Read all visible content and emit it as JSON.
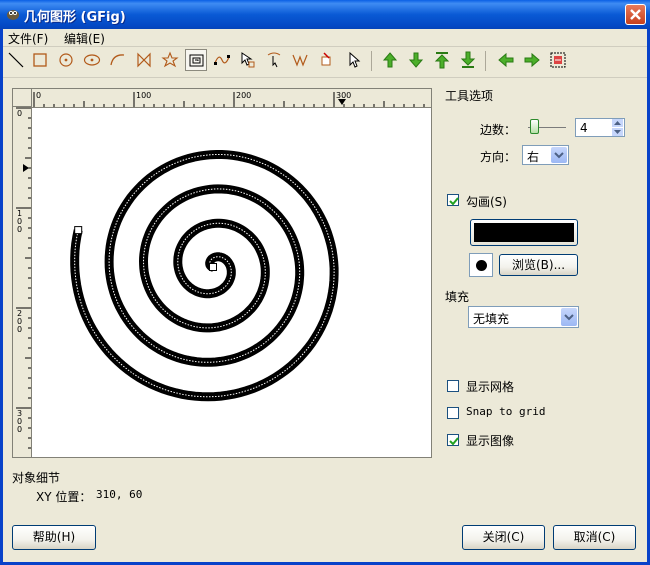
{
  "window": {
    "title": "几何图形 (GFig)"
  },
  "menu": {
    "file": "文件(F)",
    "edit": "编辑(E)"
  },
  "toolbar": {
    "tools": [
      "line-tool",
      "rectangle-tool",
      "circle-tool",
      "ellipse-tool",
      "arc-tool",
      "polygon-tool",
      "star-tool",
      "spiral-tool",
      "bezier-tool",
      "move-object-tool",
      "move-point-tool",
      "copy-object-tool",
      "delete-object-tool",
      "select-object-tool"
    ],
    "actions": [
      "raise-object",
      "lower-object",
      "raise-to-top",
      "lower-to-bottom",
      "show-previous",
      "show-next",
      "show-all"
    ],
    "active_tool": "spiral-tool"
  },
  "rulers": {
    "h_ticks": [
      "0",
      "100",
      "200",
      "300"
    ],
    "v_ticks": [
      "0",
      "100",
      "200",
      "300"
    ]
  },
  "tool_options": {
    "heading": "工具选项",
    "sides_label": "边数：",
    "sides_value": "4",
    "sides_slider_level": 0.1,
    "direction_label": "方向：",
    "direction_value": "右"
  },
  "stroke": {
    "label": "勾画(S)",
    "checked": true,
    "color": "#000000",
    "browse_button": "浏览(B)..."
  },
  "fill": {
    "label": "填充",
    "value": "无填充"
  },
  "options": {
    "show_grid": "显示网格",
    "show_grid_checked": false,
    "snap_to_grid": "Snap to grid",
    "snap_to_grid_checked": false,
    "show_image": "显示图像",
    "show_image_checked": true
  },
  "details": {
    "heading": "对象细节",
    "xy_label": "XY 位置：",
    "xy_value": "310, 60"
  },
  "buttons": {
    "help": "帮助(H)",
    "close": "关闭(C)",
    "cancel": "取消(C)"
  },
  "colors": {
    "titlebar": "#0a5ad5",
    "dialog_bg": "#ece9d8",
    "spiral": "#000000"
  }
}
